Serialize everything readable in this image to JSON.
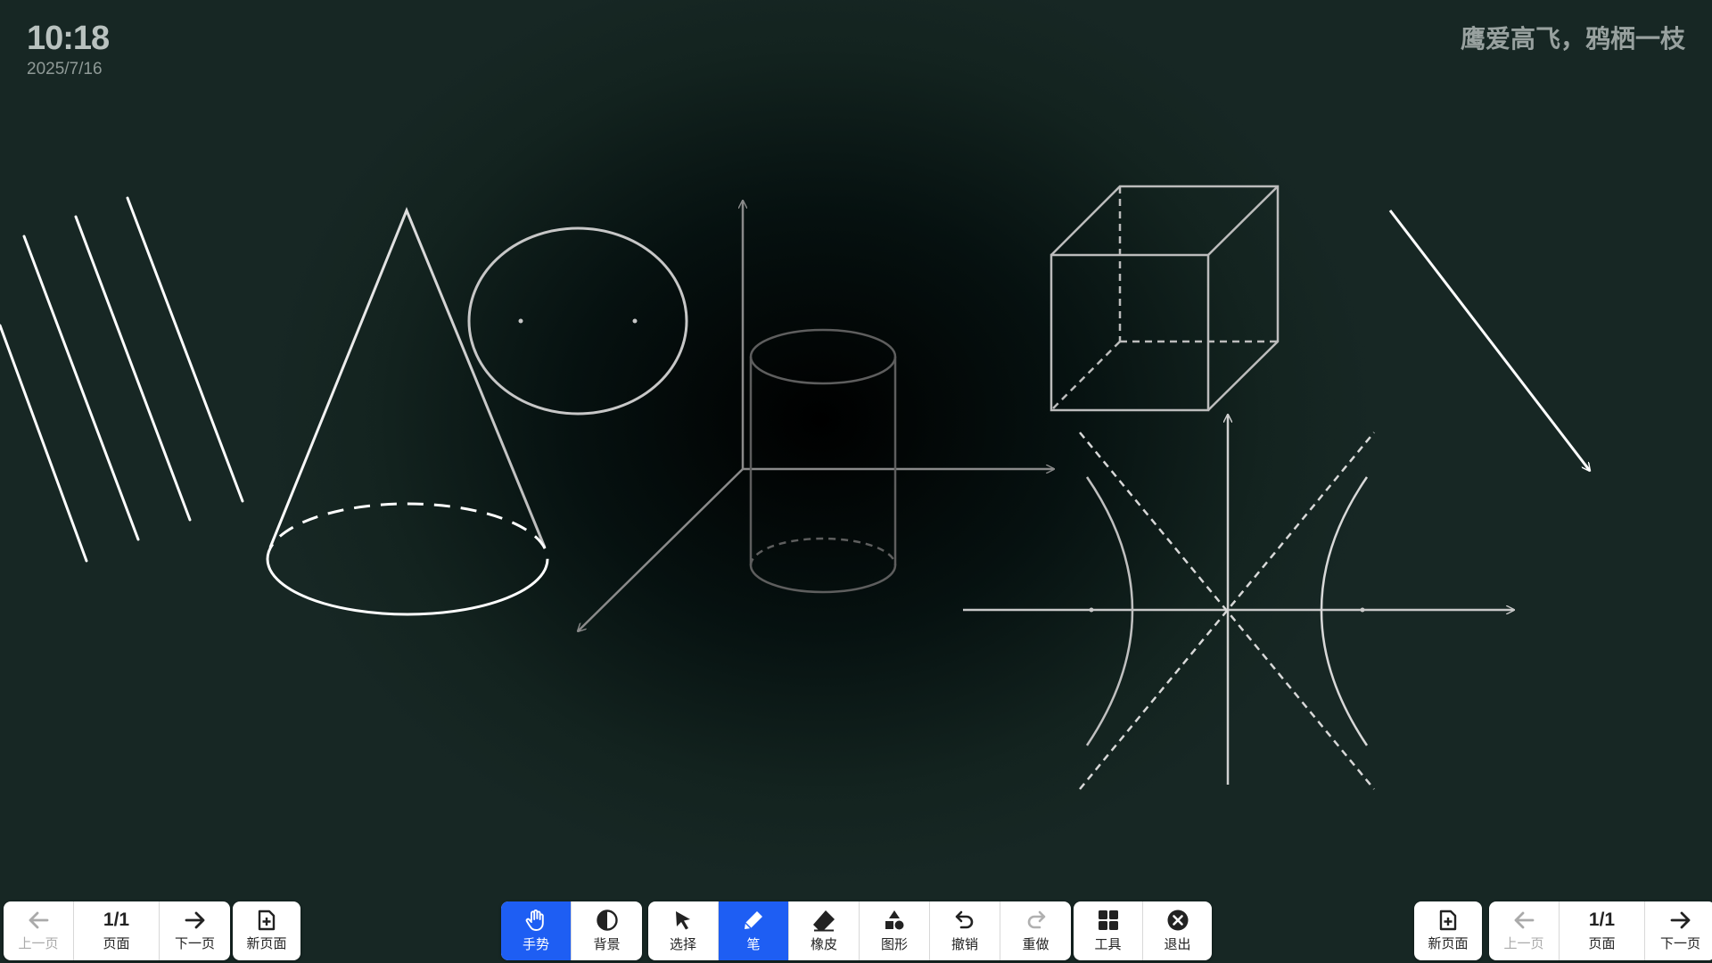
{
  "clock": {
    "time": "10:18",
    "date": "2025/7/16"
  },
  "motto": "鹰爱高飞，鸦栖一枝",
  "left_nav": {
    "prev": "上一页",
    "page": "1/1",
    "page_label": "页面",
    "next": "下一页",
    "new_page": "新页面"
  },
  "right_nav": {
    "new_page": "新页面",
    "prev": "上一页",
    "page": "1/1",
    "page_label": "页面",
    "next": "下一页"
  },
  "toolbar": {
    "gesture": "手势",
    "background": "背景",
    "select": "选择",
    "pen": "笔",
    "eraser": "橡皮",
    "shape": "图形",
    "undo": "撤销",
    "redo": "重做",
    "tools": "工具",
    "exit": "退出"
  },
  "colors": {
    "active": "#1e5ef3",
    "board": "#172724"
  },
  "icons": [
    "arrow-left-icon",
    "arrow-right-icon",
    "new-page-icon",
    "hand-icon",
    "contrast-icon",
    "cursor-icon",
    "pen-icon",
    "eraser-icon",
    "shapes-icon",
    "undo-icon",
    "redo-icon",
    "grid-icon",
    "close-circle-icon"
  ]
}
